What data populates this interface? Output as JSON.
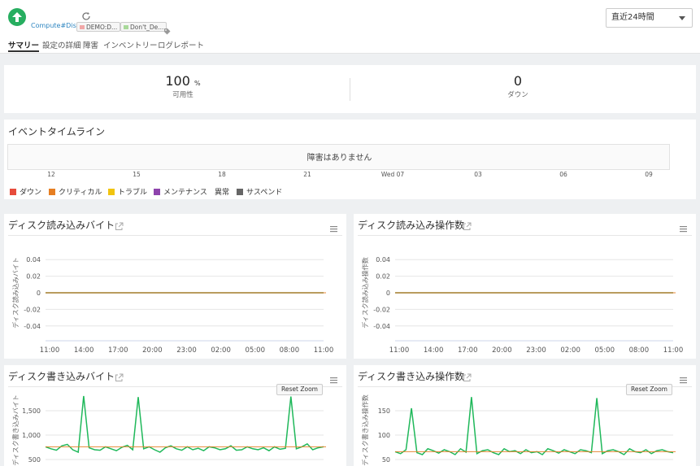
{
  "header": {
    "monitor_name": "Compute#Disk",
    "tags": [
      {
        "label": "DEMO:D...",
        "color": "#f1a7a7"
      },
      {
        "label": "Don't_De...",
        "color": "#a9d99a"
      }
    ],
    "period": "直近24時間",
    "status_color": "#27ae60"
  },
  "tabs": [
    {
      "label": "サマリー",
      "active": true
    },
    {
      "label": "設定の詳細",
      "active": false
    },
    {
      "label": "障害",
      "active": false
    },
    {
      "label": "インベントリー",
      "active": false
    },
    {
      "label": "ログレポート",
      "active": false
    }
  ],
  "stats": [
    {
      "value": "100",
      "unit": "%",
      "label": "可用性"
    },
    {
      "value": "0",
      "unit": "",
      "label": "ダウン"
    }
  ],
  "event_timeline": {
    "title": "イベントタイムライン",
    "message": "障害はありません",
    "ticks": [
      "12",
      "15",
      "18",
      "21",
      "Wed 07",
      "03",
      "06",
      "09"
    ],
    "legend": [
      {
        "label": "ダウン",
        "color": "#e74c3c"
      },
      {
        "label": "クリティカル",
        "color": "#e67e22"
      },
      {
        "label": "トラブル",
        "color": "#f1c40f"
      },
      {
        "label": "メンテナンス",
        "color": "#8e44ad"
      },
      {
        "label": "異常",
        "color": ""
      },
      {
        "label": "サスペンド",
        "color": "#666666"
      }
    ]
  },
  "chart_data": [
    {
      "type": "line",
      "title": "ディスク読み込みバイト",
      "ylabel": "ディスク読み込みバイト",
      "x": [
        "11:00",
        "14:00",
        "17:00",
        "20:00",
        "23:00",
        "02:00",
        "05:00",
        "08:00",
        "11:00"
      ],
      "yticks": [
        "0.04",
        "0.02",
        "0",
        "-0.02",
        "-0.04"
      ],
      "ylim": [
        -0.05,
        0.05
      ],
      "series": [
        {
          "values": [
            0,
            0,
            0,
            0,
            0,
            0,
            0,
            0,
            0
          ],
          "color": "#3d7a32"
        }
      ],
      "threshold": {
        "value": 0,
        "color": "#e67e22"
      }
    },
    {
      "type": "line",
      "title": "ディスク読み込み操作数",
      "ylabel": "ディスク読み込み操作数",
      "x": [
        "11:00",
        "14:00",
        "17:00",
        "20:00",
        "23:00",
        "02:00",
        "05:00",
        "08:00",
        "11:00"
      ],
      "yticks": [
        "0.04",
        "0.02",
        "0",
        "-0.02",
        "-0.04"
      ],
      "ylim": [
        -0.05,
        0.05
      ],
      "series": [
        {
          "values": [
            0,
            0,
            0,
            0,
            0,
            0,
            0,
            0,
            0
          ],
          "color": "#3d7a32"
        }
      ],
      "threshold": {
        "value": 0,
        "color": "#e67e22"
      }
    },
    {
      "type": "line",
      "title": "ディスク書き込みバイト",
      "ylabel": "ディスク書き込みバイト",
      "yticks": [
        "1,500",
        "1,000",
        "500"
      ],
      "ylim": [
        300,
        1900
      ],
      "reset_zoom": "Reset Zoom",
      "series": [
        {
          "values": [
            760,
            720,
            690,
            780,
            810,
            700,
            650,
            1800,
            740,
            700,
            690,
            760,
            720,
            680,
            750,
            790,
            700,
            1780,
            720,
            760,
            700,
            650,
            740,
            780,
            720,
            690,
            760,
            700,
            730,
            680,
            760,
            740,
            700,
            720,
            780,
            690,
            700,
            760,
            720,
            700,
            740,
            680,
            760,
            710,
            730,
            1790,
            720,
            760,
            820,
            700,
            740,
            760
          ],
          "color": "#1fb85a"
        }
      ],
      "threshold": {
        "value": 760,
        "color": "#e67e22"
      }
    },
    {
      "type": "line",
      "title": "ディスク書き込み操作数",
      "ylabel": "ディスク書き込み操作数",
      "yticks": [
        "150",
        "100",
        "50"
      ],
      "ylim": [
        30,
        190
      ],
      "reset_zoom": "Reset Zoom",
      "series": [
        {
          "values": [
            66,
            62,
            70,
            155,
            64,
            60,
            72,
            68,
            63,
            70,
            66,
            60,
            72,
            65,
            178,
            62,
            68,
            70,
            64,
            60,
            72,
            66,
            68,
            62,
            70,
            64,
            66,
            60,
            72,
            68,
            63,
            70,
            66,
            62,
            70,
            68,
            64,
            176,
            62,
            68,
            70,
            66,
            60,
            72,
            66,
            64,
            70,
            62,
            68,
            70,
            66,
            64
          ],
          "color": "#1fb85a"
        }
      ],
      "threshold": {
        "value": 66,
        "color": "#e67e22"
      }
    }
  ]
}
